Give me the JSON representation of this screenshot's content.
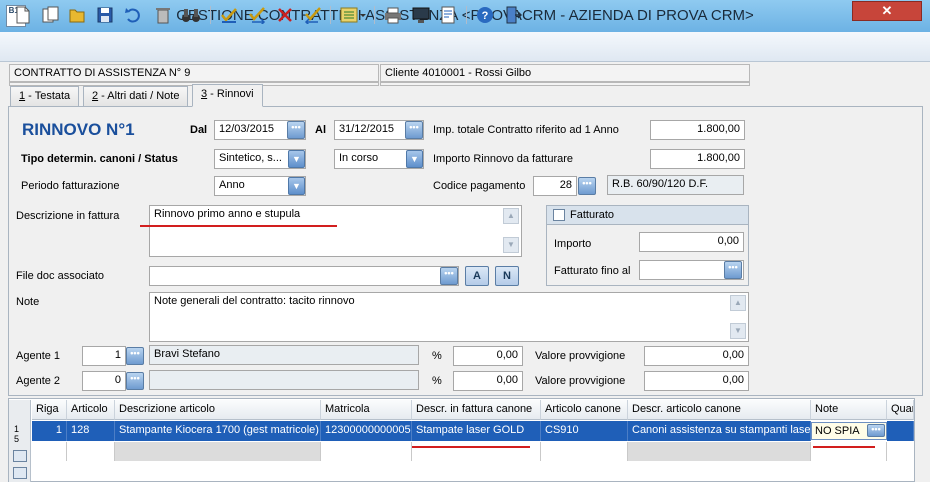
{
  "window": {
    "title": "GESTIONE CONTRATTI DI ASSISTENZA <PROVACRM - AZIENDA DI PROVA CRM>",
    "close_glyph": "✕",
    "app_icon_text": "B15"
  },
  "toolbar": {
    "buttons": [
      "new-doc-icon",
      "copy-doc-icon",
      "open-folder-icon",
      "save-icon",
      "undo-icon",
      "delete-icon",
      "binoculars-icon",
      "check-icon",
      "check-arrow-icon",
      "cross-icon",
      "check-back-icon",
      "list-dropdown-icon",
      "print-icon",
      "monitor-icon",
      "document-edit-icon",
      "help-icon",
      "exit-icon"
    ]
  },
  "header": {
    "contract": "CONTRATTO DI ASSISTENZA N° 9",
    "client": "Cliente 4010001 - Rossi Gilbo"
  },
  "tabs": [
    {
      "key": "1",
      "rest": " - Testata"
    },
    {
      "key": "2",
      "rest": " - Altri dati / Note"
    },
    {
      "key": "3",
      "rest": " - Rinnovi"
    }
  ],
  "form": {
    "heading": "RINNOVO N°1",
    "dal_label": "Dal",
    "dal_value": "12/03/2015",
    "al_label": "Al",
    "al_value": "31/12/2015",
    "imp_totale_label": "Imp. totale Contratto riferito ad 1 Anno",
    "imp_totale_value": "1.800,00",
    "tipo_label": "Tipo determin. canoni / Status",
    "tipo_value": "Sintetico, s...",
    "status_value": "In corso",
    "importo_rinnovo_label": "Importo Rinnovo da fatturare",
    "importo_rinnovo_value": "1.800,00",
    "periodo_label": "Periodo fatturazione",
    "periodo_value": "Anno",
    "codice_pag_label": "Codice pagamento",
    "codice_pag_value": "28",
    "codice_pag_desc": "R.B. 60/90/120 D.F.",
    "descrizione_label": "Descrizione in fattura",
    "descrizione_value": "Rinnovo primo anno e stupula",
    "file_label": "File doc associato",
    "file_value": "",
    "btn_a": "A",
    "btn_n": "N",
    "note_label": "Note",
    "note_value": "Note generali del contratto: tacito rinnovo",
    "fatturato_label": "Fatturato",
    "fatt_importo_label": "Importo",
    "fatt_importo_value": "0,00",
    "fatt_fino_label": "Fatturato fino al",
    "fatt_fino_value": "",
    "agente1_label": "Agente 1",
    "agente1_code": "1",
    "agente1_name": "Bravi Stefano",
    "agente1_pct": "0,00",
    "agente2_label": "Agente 2",
    "agente2_code": "0",
    "agente2_name": "",
    "agente2_pct": "0,00",
    "pct_symbol": "%",
    "valore_prov_label": "Valore provvigione",
    "valore_prov1": "0,00",
    "valore_prov2": "0,00",
    "ellipsis": "•••",
    "arrow_down": "▼",
    "arrow_up": "▲"
  },
  "grid": {
    "columns": [
      "Riga",
      "Articolo",
      "Descrizione articolo",
      "Matricola",
      "Descr. in fattura canone",
      "Articolo canone",
      "Descr. articolo canone",
      "Note",
      "Quan"
    ],
    "row": {
      "riga": "1",
      "articolo": "128",
      "descrizione": "Stampante Kiocera 1700  (gest matricole)",
      "matricola": "12300000000005",
      "descr_fattura": "Stampate laser GOLD",
      "articolo_canone": "CS910",
      "descr_art_canone": "Canoni assistenza su stampanti laser",
      "note": "NO SPIA"
    },
    "indicator_text": "1\n5"
  },
  "colors": {
    "title_bar": "#7cbde8",
    "heading": "#1a4f9c",
    "selection": "#1f5fb8",
    "red_underline": "#d21e1e"
  }
}
